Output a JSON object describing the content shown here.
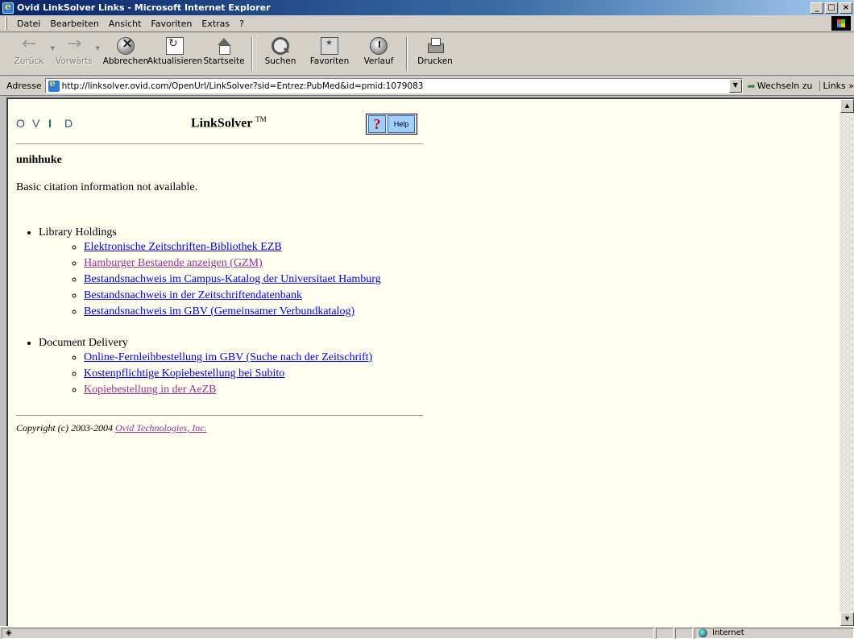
{
  "window": {
    "title": "Ovid LinkSolver Links - Microsoft Internet Explorer",
    "min_label": "_",
    "max_label": "□",
    "close_label": "×"
  },
  "menu": {
    "items": [
      "Datei",
      "Bearbeiten",
      "Ansicht",
      "Favoriten",
      "Extras",
      "?"
    ]
  },
  "toolbar": {
    "back": "Zurück",
    "forward": "Vorwärts",
    "stop": "Abbrechen",
    "refresh": "Aktualisieren",
    "home": "Startseite",
    "search": "Suchen",
    "favorites": "Favoriten",
    "history": "Verlauf",
    "print": "Drucken"
  },
  "address": {
    "label": "Adresse",
    "url": "http://linksolver.ovid.com/OpenUrl/LinkSolver?sid=Entrez:PubMed&id=pmid:1079083",
    "go_label": "Wechseln zu",
    "links_label": "Links »"
  },
  "page": {
    "logo_letters": [
      "O",
      "V",
      "I",
      "D"
    ],
    "title": "LinkSolver",
    "title_mark": "TM",
    "help_q": "?",
    "help_label": "Help",
    "user": "unihhuke",
    "citation_message": "Basic citation information not available.",
    "sections": [
      {
        "heading": "Library Holdings",
        "links": [
          {
            "text": "Elektronische Zeitschriften-Bibliothek EZB",
            "visited": false
          },
          {
            "text": "Hamburger Bestaende anzeigen (GZM)",
            "visited": true
          },
          {
            "text": "Bestandsnachweis im Campus-Katalog der Universitaet Hamburg",
            "visited": false
          },
          {
            "text": "Bestandsnachweis in der Zeitschriftendatenbank",
            "visited": false
          },
          {
            "text": "Bestandsnachweis im GBV (Gemeinsamer Verbundkatalog)",
            "visited": false
          }
        ]
      },
      {
        "heading": "Document Delivery",
        "links": [
          {
            "text": "Online-Fernleihbestellung im GBV (Suche nach der Zeitschrift)",
            "visited": false
          },
          {
            "text": "Kostenpflichtige Kopiebestellung bei Subito",
            "visited": false
          },
          {
            "text": "Kopiebestellung in der AeZB",
            "visited": true
          }
        ]
      }
    ],
    "copyright_prefix": "Copyright (c) 2003-2004 ",
    "copyright_link": "Ovid Technologies, Inc."
  },
  "status": {
    "zone": "Internet"
  }
}
